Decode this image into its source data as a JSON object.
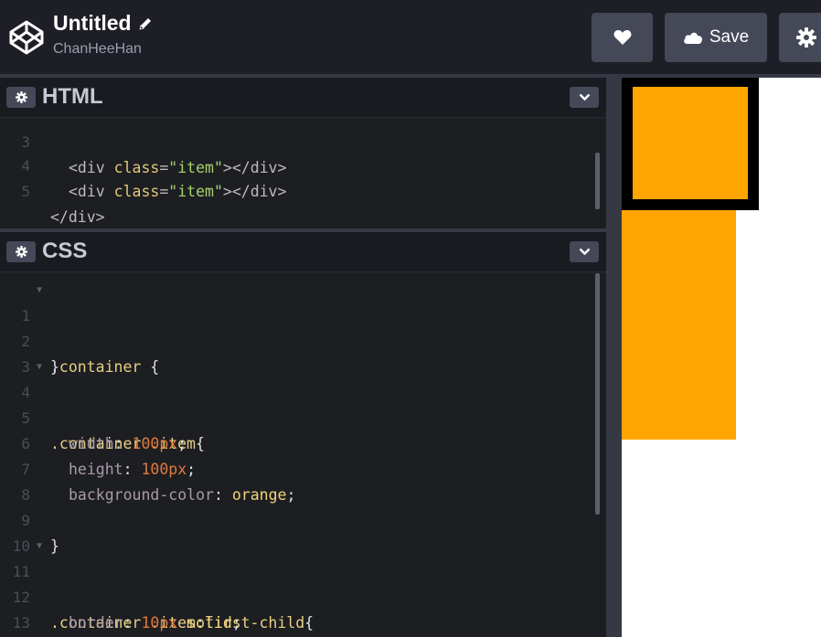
{
  "header": {
    "title": "Untitled",
    "user": "ChanHeeHan",
    "save_label": "Save",
    "icons": [
      "codepen-logo-icon",
      "pencil-icon",
      "heart-icon",
      "cloud-icon",
      "gear-icon"
    ]
  },
  "html_editor": {
    "title": "HTML",
    "lines": [
      {
        "n": "3",
        "text": "<div class=\"item\"></div>"
      },
      {
        "n": "4",
        "text": "<div class=\"item\"></div>"
      },
      {
        "n": "5",
        "text": "</div>"
      }
    ]
  },
  "css_editor": {
    "title": "CSS",
    "lines": [
      {
        "n": "1",
        "text": ".container {"
      },
      {
        "n": "2",
        "text": "}"
      },
      {
        "n": "3",
        "text": ""
      },
      {
        "n": "4",
        "text": ".container .item{"
      },
      {
        "n": "5",
        "text": "width: 100px;"
      },
      {
        "n": "6",
        "text": "height: 100px;"
      },
      {
        "n": "7",
        "text": "background-color: orange;"
      },
      {
        "n": "8",
        "text": ""
      },
      {
        "n": "9",
        "text": "}"
      },
      {
        "n": "10",
        "text": ""
      },
      {
        "n": "11",
        "text": ".container .item:first-child{"
      },
      {
        "n": "12",
        "text": "border: 10px solid;"
      },
      {
        "n": "13",
        "text": "}"
      }
    ]
  },
  "preview": {
    "item_color": "#ffa500",
    "border_color": "#000000"
  },
  "colors": {
    "header_bg": "#1e1f26",
    "button_bg": "#444857",
    "editor_bg": "#1d1e22"
  }
}
